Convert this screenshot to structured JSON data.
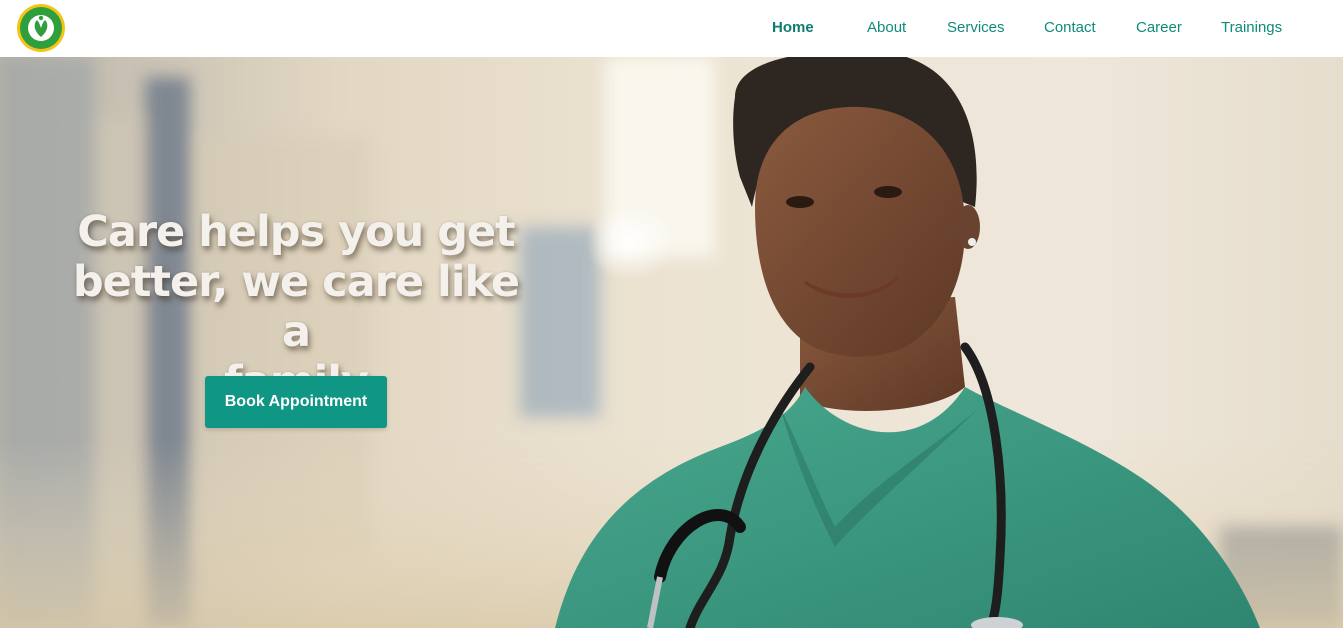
{
  "header": {
    "logo_name": "medical-care-logo",
    "nav": [
      {
        "label": "Home",
        "active": true
      },
      {
        "label": "About",
        "active": false
      },
      {
        "label": "Services",
        "active": false
      },
      {
        "label": "Contact",
        "active": false
      },
      {
        "label": "Career",
        "active": false
      },
      {
        "label": "Trainings",
        "active": false
      }
    ]
  },
  "hero": {
    "headline_line1": "Care helps you get",
    "headline_line2": "better, we care like a",
    "headline_line3": "family",
    "cta_label": "Book Appointment",
    "image_subject": "smiling nurse in green scrubs with stethoscope in hospital corridor"
  },
  "colors": {
    "brand": "#0f9684",
    "nav_text": "#0f8a7c",
    "headline": "#f4f1ec",
    "scrubs": "#3f9c84"
  }
}
